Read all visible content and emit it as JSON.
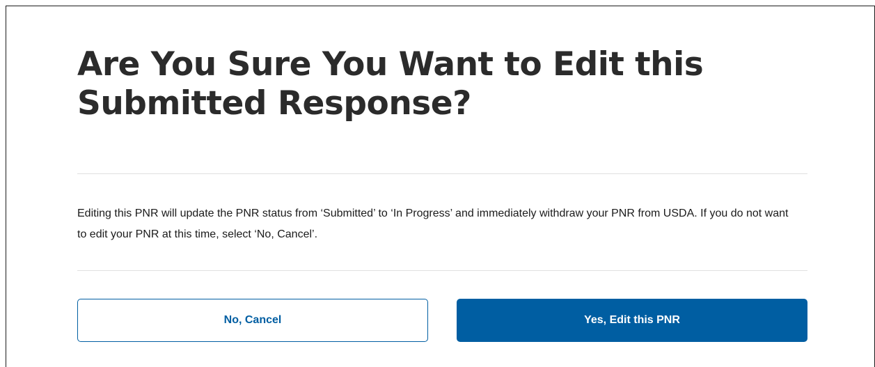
{
  "modal": {
    "title": "Are You Sure You Want to Edit this Submitted Response?",
    "body": "Editing this PNR will update the PNR status from ‘Submitted’ to ‘In Progress’ and immediately withdraw your PNR from USDA. If you do not want to edit your PNR at this time, select ‘No, Cancel’.",
    "cancel_label": "No, Cancel",
    "confirm_label": "Yes, Edit this PNR"
  },
  "colors": {
    "primary": "#005ea2",
    "title_text": "#2b2b2b",
    "body_text": "#1b1b1b",
    "divider": "#e0e0e0"
  }
}
